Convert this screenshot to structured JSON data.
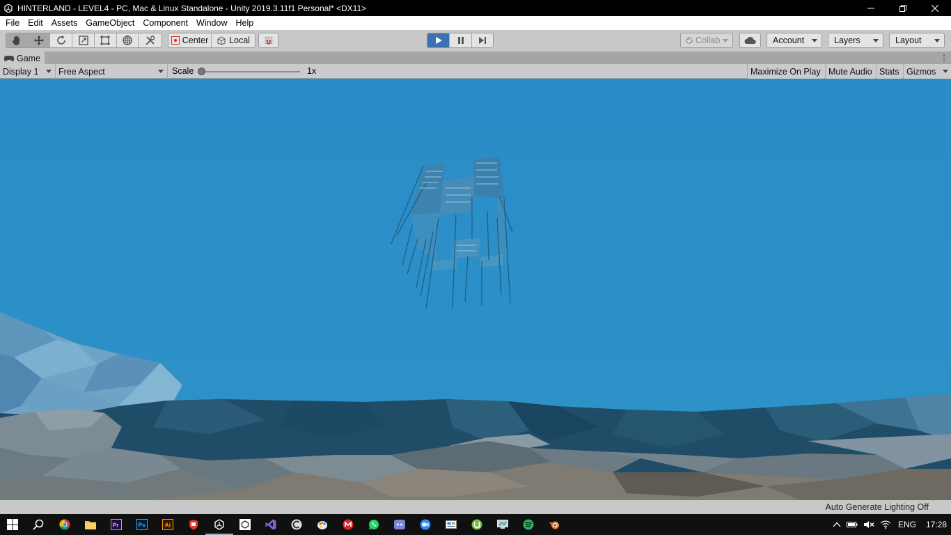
{
  "window": {
    "title": "HINTERLAND - LEVEL4 - PC, Mac & Linux Standalone - Unity 2019.3.11f1 Personal* <DX11>",
    "minimize_icon": "minimize-icon",
    "maximize_icon": "restore-icon",
    "close_icon": "close-icon"
  },
  "menu": {
    "items": [
      "File",
      "Edit",
      "Assets",
      "GameObject",
      "Component",
      "Window",
      "Help"
    ]
  },
  "toolbar": {
    "tools": [
      {
        "name": "hand-tool",
        "icon": "hand-icon",
        "active": true
      },
      {
        "name": "move-tool",
        "icon": "move-icon",
        "active": true
      },
      {
        "name": "rotate-tool",
        "icon": "rotate-icon",
        "active": false
      },
      {
        "name": "scale-tool",
        "icon": "scale-icon",
        "active": false
      },
      {
        "name": "rect-tool",
        "icon": "rect-icon",
        "active": false
      },
      {
        "name": "transform-tool",
        "icon": "transform-icon",
        "active": false
      },
      {
        "name": "custom-tool",
        "icon": "tools-icon",
        "active": false
      }
    ],
    "pivot_label": "Center",
    "space_label": "Local",
    "collab_label": "Collab",
    "account_label": "Account",
    "layers_label": "Layers",
    "layout_label": "Layout"
  },
  "game_tab": {
    "label": "Game"
  },
  "game_controls": {
    "display": "Display 1",
    "aspect": "Free Aspect",
    "scale_label": "Scale",
    "scale_value": "1x",
    "scale_fraction": 0.0,
    "maximize_on_play": "Maximize On Play",
    "mute_audio": "Mute Audio",
    "stats": "Stats",
    "gizmos": "Gizmos"
  },
  "status": {
    "text": "Auto Generate Lighting Off"
  },
  "taskbar": {
    "apps": [
      "start-icon",
      "search-icon",
      "chrome-icon",
      "file-explorer-icon",
      "premiere-icon",
      "photoshop-icon",
      "illustrator-icon",
      "git-icon",
      "unity-icon",
      "unity-hub-icon",
      "visual-studio-icon",
      "ccleaner-icon",
      "paint-icon",
      "mega-icon",
      "whatsapp-icon",
      "discord-icon",
      "zoom-icon",
      "news-icon",
      "utorrent-icon",
      "remote-desktop-icon",
      "spotify-icon",
      "blender-icon"
    ],
    "app_badges": {
      "premiere": "Pr",
      "photoshop": "Ps",
      "illustrator": "Ai"
    },
    "language": "ENG",
    "time": "17:28"
  },
  "colors": {
    "sky": "#2a8dc9",
    "play_active": "#3a72b0",
    "editor_gray": "#c8c8c8"
  }
}
